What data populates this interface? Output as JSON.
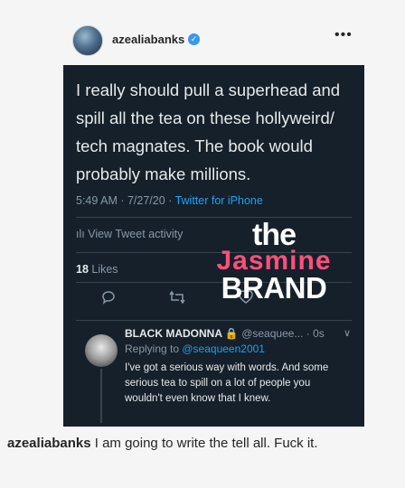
{
  "post": {
    "username": "azealiabanks",
    "more_glyph": "•••",
    "verified_icon": "verified-badge-icon"
  },
  "tweet": {
    "text": "I really should pull a superhead and spill all the tea on these hollyweird/ tech magnates. The book would probably make millions.",
    "time": "5:49 AM · 7/27/20 · ",
    "source": "Twitter for iPhone",
    "activity": "View Tweet activity",
    "likes_count": "18",
    "likes_label": " Likes"
  },
  "reply": {
    "name": "BLACK MADONNA",
    "handle_time": "@seaquee... · 0s",
    "replying_prefix": "Replying to ",
    "replying_handle": "@seaqueen2001",
    "text": "I've got a serious way with words. And some serious tea to spill on a lot of people you wouldn't even know that I knew."
  },
  "watermark": {
    "line1": "the",
    "line2": "Jasmine",
    "line3": "BRAND"
  },
  "caption": {
    "username": "azealiabanks",
    "text": " I am going to write the tell all. Fuck it."
  }
}
